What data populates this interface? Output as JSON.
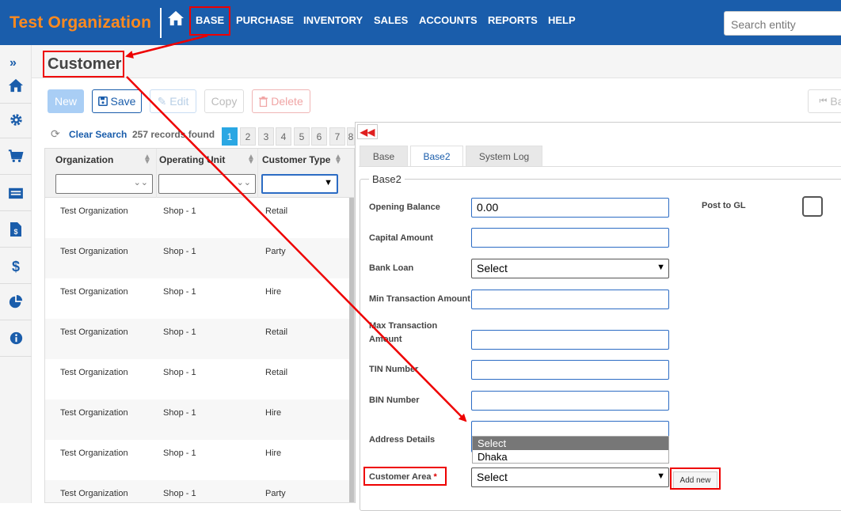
{
  "header": {
    "org_title": "Test Organization",
    "nav": [
      "BASE",
      "PURCHASE",
      "INVENTORY",
      "SALES",
      "ACCOUNTS",
      "REPORTS",
      "HELP"
    ],
    "search_placeholder": "Search entity"
  },
  "sidebar": {
    "expand": "»",
    "icons": [
      "home-icon",
      "gear-icon",
      "cart-icon",
      "bank-icon",
      "invoice-icon",
      "dollar-icon",
      "pie-chart-icon",
      "info-icon"
    ]
  },
  "page": {
    "title": "Customer"
  },
  "toolbar": {
    "new": "New",
    "save": "Save",
    "edit": "Edit",
    "copy": "Copy",
    "delete": "Delete",
    "back": "Ba"
  },
  "grid": {
    "clear_search": "Clear Search",
    "records": "257 records found",
    "pages": [
      "1",
      "2",
      "3",
      "4",
      "5",
      "6",
      "7",
      "8"
    ],
    "columns": [
      "Organization",
      "Operating Unit",
      "Customer Type"
    ],
    "rows": [
      [
        "Test Organization",
        "Shop - 1",
        "Retail"
      ],
      [
        "Test Organization",
        "Shop - 1",
        "Party"
      ],
      [
        "Test Organization",
        "Shop - 1",
        "Hire"
      ],
      [
        "Test Organization",
        "Shop - 1",
        "Retail"
      ],
      [
        "Test Organization",
        "Shop - 1",
        "Retail"
      ],
      [
        "Test Organization",
        "Shop - 1",
        "Hire"
      ],
      [
        "Test Organization",
        "Shop - 1",
        "Hire"
      ],
      [
        "Test Organization",
        "Shop - 1",
        "Party"
      ]
    ]
  },
  "panel": {
    "tabs": [
      "Base",
      "Base2",
      "System Log"
    ],
    "active_tab": "Base2",
    "legend": "Base2",
    "fields": {
      "opening_balance": {
        "label": "Opening Balance",
        "value": "0.00"
      },
      "capital_amount": {
        "label": "Capital Amount",
        "value": ""
      },
      "bank_loan": {
        "label": "Bank Loan",
        "value": "Select"
      },
      "min_txn": {
        "label": "Min Transaction Amount",
        "value": ""
      },
      "max_txn": {
        "label1": "Max Transaction",
        "label2": "Amount",
        "value": ""
      },
      "tin": {
        "label": "TIN Number",
        "value": ""
      },
      "bin": {
        "label": "BIN Number",
        "value": ""
      },
      "address": {
        "label": "Address Details",
        "value": ""
      },
      "customer_area": {
        "label": "Customer Area",
        "required": "*",
        "value": "Select"
      }
    },
    "post_to_gl": "Post to GL",
    "dropdown_options": [
      "Select",
      "Dhaka"
    ],
    "add_new": "Add new"
  },
  "colors": {
    "nav_bg": "#1a5dab",
    "org_title": "#ff8a1e",
    "annotation": "#e00000",
    "active_page": "#2aa7e3"
  }
}
